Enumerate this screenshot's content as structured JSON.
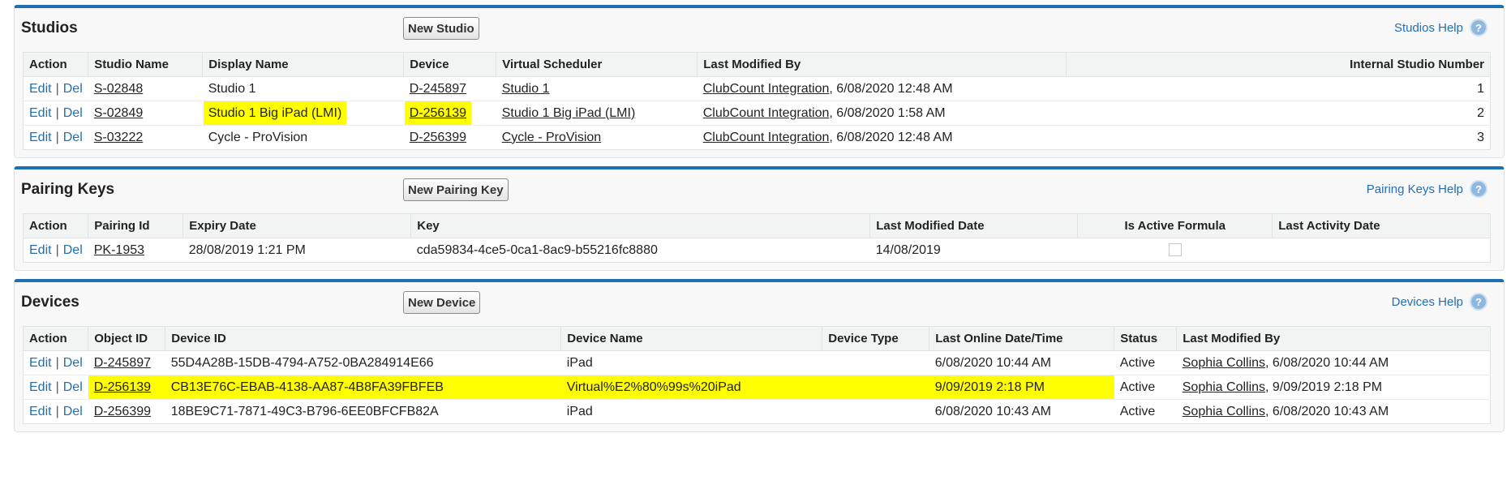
{
  "studios": {
    "title": "Studios",
    "new_button": "New Studio",
    "help": "Studios Help",
    "columns": [
      "Action",
      "Studio Name",
      "Display Name",
      "Device",
      "Virtual Scheduler",
      "Last Modified By",
      "Internal Studio Number"
    ],
    "rows": [
      {
        "edit": "Edit",
        "sep": "|",
        "del": "Del",
        "name": "S-02848",
        "display": "Studio 1",
        "device": "D-245897",
        "scheduler": "Studio 1",
        "modified_by": "ClubCount Integration",
        "modified_date": ", 6/08/2020 12:48 AM",
        "number": "1"
      },
      {
        "edit": "Edit",
        "sep": "|",
        "del": "Del",
        "name": "S-02849",
        "display": "Studio 1 Big iPad (LMI)",
        "device": "D-256139",
        "scheduler": "Studio 1 Big iPad (LMI)",
        "modified_by": "ClubCount Integration",
        "modified_date": ", 6/08/2020 1:58 AM",
        "number": "2"
      },
      {
        "edit": "Edit",
        "sep": "|",
        "del": "Del",
        "name": "S-03222",
        "display": "Cycle - ProVision",
        "device": "D-256399",
        "scheduler": "Cycle - ProVision",
        "modified_by": "ClubCount Integration",
        "modified_date": ", 6/08/2020 12:48 AM",
        "number": "3"
      }
    ]
  },
  "pairing": {
    "title": "Pairing Keys",
    "new_button": "New Pairing Key",
    "help": "Pairing Keys Help",
    "columns": [
      "Action",
      "Pairing Id",
      "Expiry Date",
      "Key",
      "Last Modified Date",
      "Is Active Formula",
      "Last Activity Date"
    ],
    "rows": [
      {
        "edit": "Edit",
        "sep": "|",
        "del": "Del",
        "id": "PK-1953",
        "expiry": "28/08/2019 1:21 PM",
        "key": "cda59834-4ce5-0ca1-8ac9-b55216fc8880",
        "modified": "14/08/2019",
        "active": false,
        "activity": ""
      }
    ]
  },
  "devices": {
    "title": "Devices",
    "new_button": "New Device",
    "help": "Devices Help",
    "columns": [
      "Action",
      "Object ID",
      "Device ID",
      "Device Name",
      "Device Type",
      "Last Online Date/Time",
      "Status",
      "Last Modified By"
    ],
    "rows": [
      {
        "edit": "Edit",
        "sep": "|",
        "del": "Del",
        "object_id": "D-245897",
        "device_id": "55D4A28B-15DB-4794-A752-0BA284914E66",
        "device_name": "iPad",
        "device_type": "",
        "last_online": "6/08/2020 10:44 AM",
        "status": "Active",
        "modified_by": "Sophia Collins",
        "modified_date": ", 6/08/2020 10:44 AM"
      },
      {
        "edit": "Edit",
        "sep": "|",
        "del": "Del",
        "object_id": "D-256139",
        "device_id": "CB13E76C-EBAB-4138-AA87-4B8FA39FBFEB",
        "device_name": "Virtual%E2%80%99s%20iPad",
        "device_type": "",
        "last_online": "9/09/2019 2:18 PM",
        "status": "Active",
        "modified_by": "Sophia Collins",
        "modified_date": ", 9/09/2019 2:18 PM"
      },
      {
        "edit": "Edit",
        "sep": "|",
        "del": "Del",
        "object_id": "D-256399",
        "device_id": "18BE9C71-7871-49C3-B796-6EE0BFCFB82A",
        "device_name": "iPad",
        "device_type": "",
        "last_online": "6/08/2020 10:43 AM",
        "status": "Active",
        "modified_by": "Sophia Collins",
        "modified_date": ", 6/08/2020 10:43 AM"
      }
    ]
  },
  "colors": {
    "accent": "#1f6fb5",
    "highlight": "#ffff00"
  }
}
